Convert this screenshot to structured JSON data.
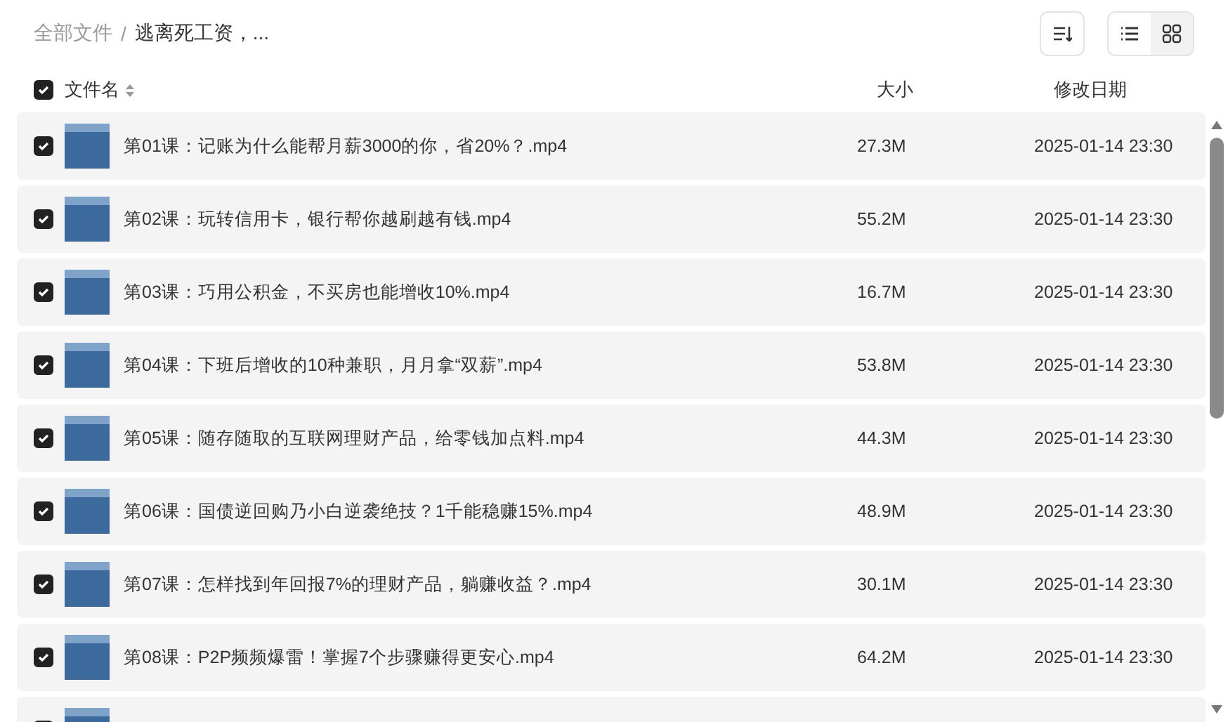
{
  "breadcrumb": [
    {
      "label": "全部文件",
      "current": false
    },
    {
      "label": "逃离死工资，...",
      "current": true
    }
  ],
  "breadcrumb_separator": "/",
  "view_toggle": [
    {
      "kind": "list",
      "selected": false
    },
    {
      "kind": "grid",
      "selected": true
    }
  ],
  "table": {
    "select_all": {
      "checked": true
    },
    "columns": [
      "文件名",
      "大小",
      "修改日期"
    ],
    "rows": [
      {
        "checked": true,
        "name": "第01课：记账为什么能帮月薪3000的你，省20%？.mp4",
        "size": "27.3M",
        "date": "2025-01-14 23:30"
      },
      {
        "checked": true,
        "name": "第02课：玩转信用卡，银行帮你越刷越有钱.mp4",
        "size": "55.2M",
        "date": "2025-01-14 23:30"
      },
      {
        "checked": true,
        "name": "第03课：巧用公积金，不买房也能增收10%.mp4",
        "size": "16.7M",
        "date": "2025-01-14 23:30"
      },
      {
        "checked": true,
        "name": "第04课：下班后增收的10种兼职，月月拿“双薪”.mp4",
        "size": "53.8M",
        "date": "2025-01-14 23:30"
      },
      {
        "checked": true,
        "name": "第05课：随存随取的互联网理财产品，给零钱加点料.mp4",
        "size": "44.3M",
        "date": "2025-01-14 23:30"
      },
      {
        "checked": true,
        "name": "第06课：国债逆回购乃小白逆袭绝技？1千能稳赚15%.mp4",
        "size": "48.9M",
        "date": "2025-01-14 23:30"
      },
      {
        "checked": true,
        "name": "第07课：怎样找到年回报7%的理财产品，躺赚收益？.mp4",
        "size": "30.1M",
        "date": "2025-01-14 23:30"
      },
      {
        "checked": true,
        "name": "第08课：P2P频频爆雷！掌握7个步骤赚得更安心.mp4",
        "size": "64.2M",
        "date": "2025-01-14 23:30"
      },
      {
        "checked": true
      }
    ]
  }
}
